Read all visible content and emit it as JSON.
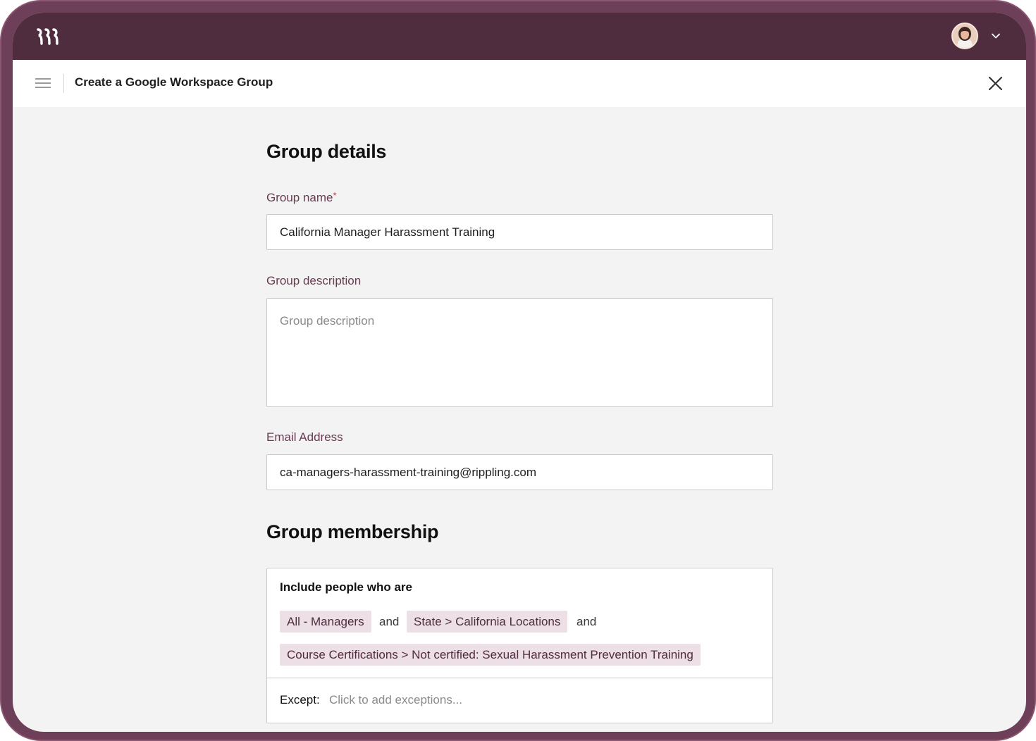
{
  "colors": {
    "frame": "#6e3f58",
    "topbar": "#4f2c3e",
    "accent_label": "#6a3a52",
    "chip_bg": "#eddfe6",
    "page_bg": "#f3f3f3"
  },
  "topbar": {
    "logo_icon": "rippling-logo-icon",
    "avatar_icon": "user-avatar",
    "menu_caret_icon": "chevron-down-icon"
  },
  "header": {
    "menu_icon": "hamburger-menu-icon",
    "title": "Create a Google Workspace Group",
    "close_icon": "close-icon"
  },
  "group_details": {
    "heading": "Group details",
    "name_label": "Group name",
    "name_required_mark": "*",
    "name_value": "California Manager Harassment Training",
    "description_label": "Group description",
    "description_value": "",
    "description_placeholder": "Group description",
    "email_label": "Email Address",
    "email_value": "ca-managers-harassment-training@rippling.com"
  },
  "group_membership": {
    "heading": "Group membership",
    "include_label": "Include people who are",
    "rules": [
      {
        "chip": "All - Managers",
        "conjunction": "and"
      },
      {
        "chip": "State > California Locations",
        "conjunction": "and"
      },
      {
        "chip": "Course Certifications > Not certified: Sexual Harassment Prevention Training",
        "conjunction": ""
      }
    ],
    "except_label": "Except:",
    "except_placeholder": "Click to add exceptions..."
  }
}
